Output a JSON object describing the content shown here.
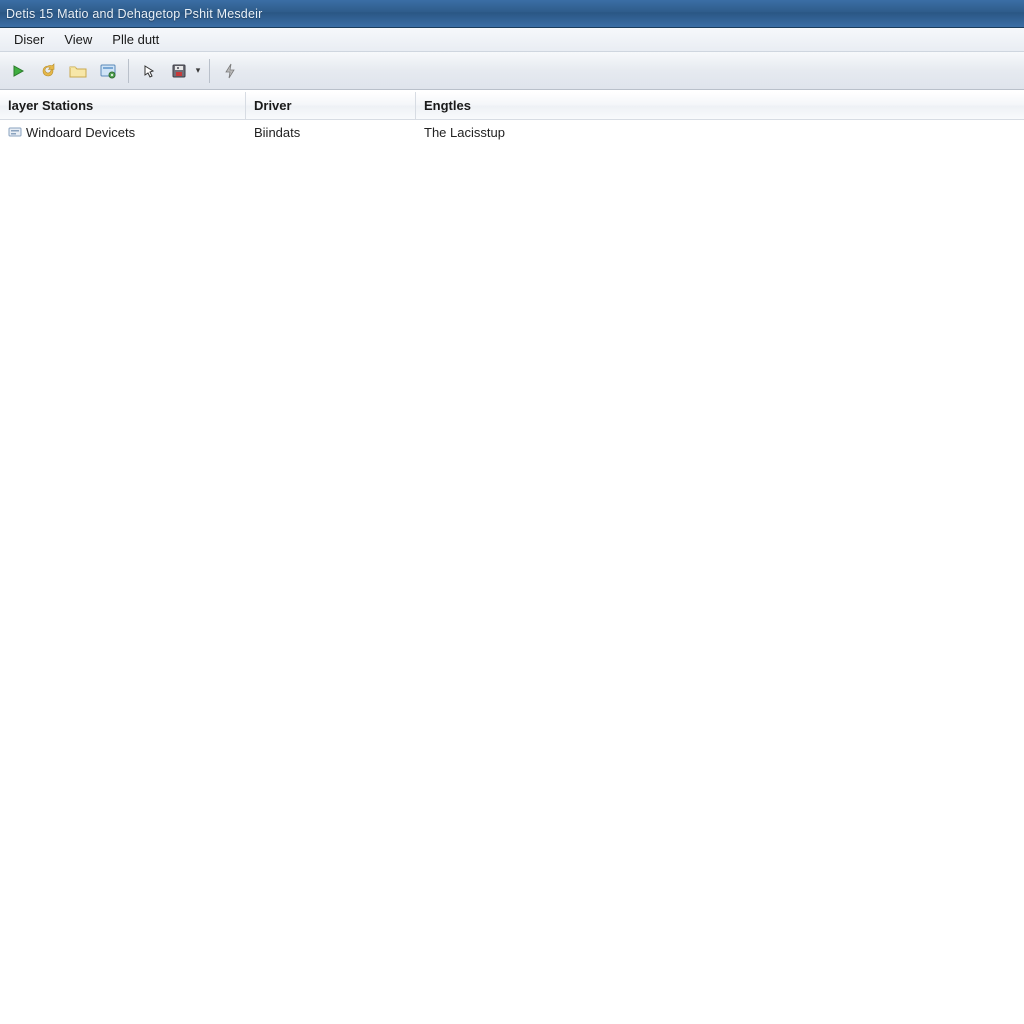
{
  "window": {
    "title": "Detis 15 Matio and Dehagetop Pshit Mesdeir"
  },
  "menu": {
    "items": [
      "Diser",
      "View",
      "Plle dutt"
    ]
  },
  "toolbar": {
    "buttons": [
      {
        "name": "play-icon"
      },
      {
        "name": "refresh-icon"
      },
      {
        "name": "folder-icon"
      },
      {
        "name": "database-icon"
      }
    ],
    "buttons2": [
      {
        "name": "pointer-icon"
      },
      {
        "name": "save-icon"
      }
    ],
    "buttons3": [
      {
        "name": "lightning-icon"
      }
    ]
  },
  "listview": {
    "columns": [
      "layer Stations",
      "Driver",
      "Engtles"
    ],
    "rows": [
      {
        "c0": "Windoard Devicets",
        "c1": "Biindats",
        "c2": "The Lacisstup"
      }
    ]
  }
}
